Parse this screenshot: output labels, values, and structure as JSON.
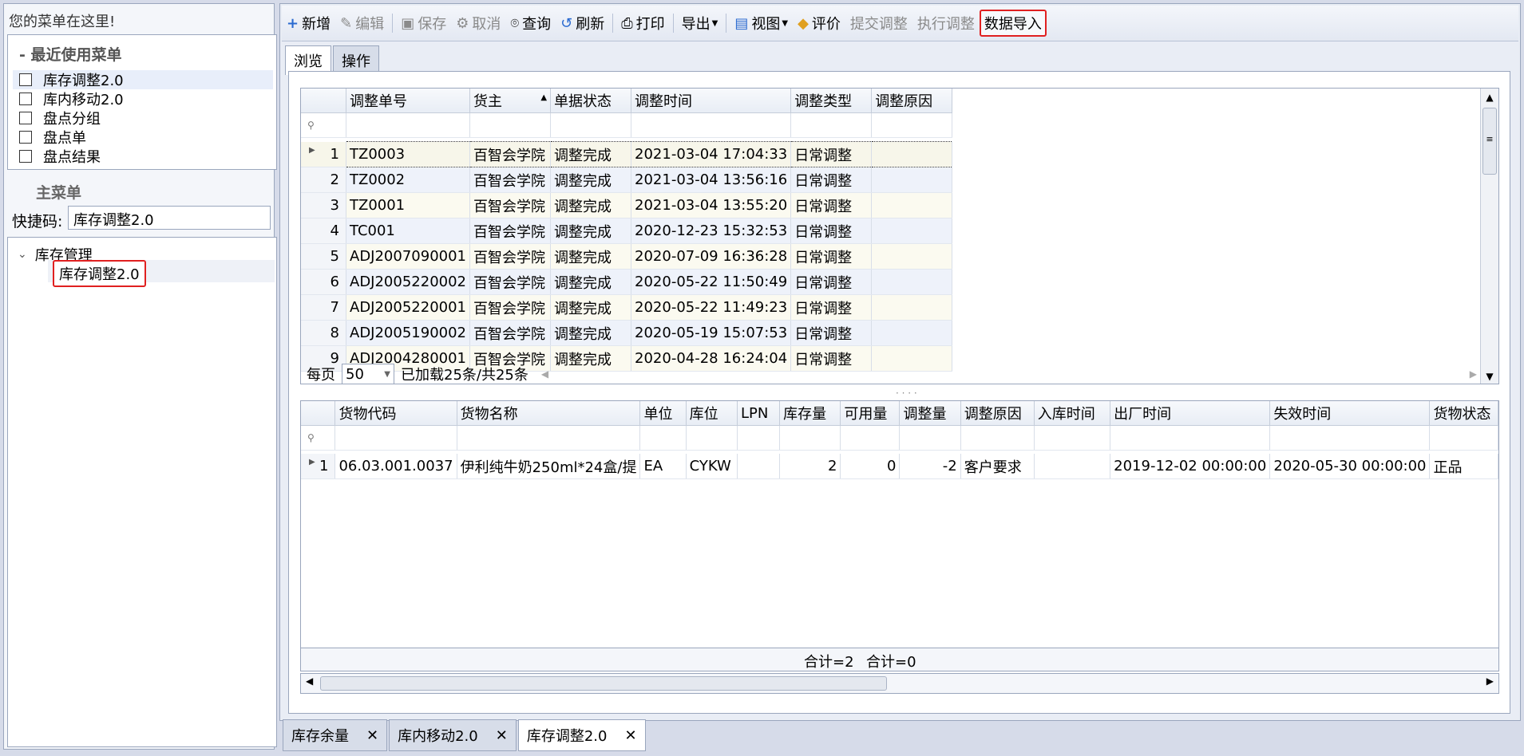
{
  "left_panel": {
    "title": "您的菜单在这里!",
    "recent": {
      "header": "- 最近使用菜单",
      "items": [
        "库存调整2.0",
        "库内移动2.0",
        "盘点分组",
        "盘点单",
        "盘点结果"
      ]
    },
    "main_menu": {
      "header": "主菜单",
      "shortcut_label": "快捷码:",
      "shortcut_value": "库存调整2.0"
    },
    "tree": {
      "root_label": "库存管理",
      "child_label": "库存调整2.0"
    }
  },
  "toolbar": {
    "new": "新增",
    "edit": "编辑",
    "save": "保存",
    "cancel": "取消",
    "query": "查询",
    "refresh": "刷新",
    "print": "打印",
    "export": "导出",
    "view": "视图",
    "rate": "评价",
    "submit_adjust": "提交调整",
    "execute_adjust": "执行调整",
    "data_import": "数据导入"
  },
  "tabs": [
    "浏览",
    "操作"
  ],
  "grid1": {
    "columns": [
      "调整单号",
      "货主",
      "单据状态",
      "调整时间",
      "调整类型",
      "调整原因"
    ],
    "rows": [
      [
        "1",
        "TZ0003",
        "百智会学院",
        "调整完成",
        "2021-03-04 17:04:33",
        "日常调整",
        ""
      ],
      [
        "2",
        "TZ0002",
        "百智会学院",
        "调整完成",
        "2021-03-04 13:56:16",
        "日常调整",
        ""
      ],
      [
        "3",
        "TZ0001",
        "百智会学院",
        "调整完成",
        "2021-03-04 13:55:20",
        "日常调整",
        ""
      ],
      [
        "4",
        "TC001",
        "百智会学院",
        "调整完成",
        "2020-12-23 15:32:53",
        "日常调整",
        ""
      ],
      [
        "5",
        "ADJ2007090001",
        "百智会学院",
        "调整完成",
        "2020-07-09 16:36:28",
        "日常调整",
        ""
      ],
      [
        "6",
        "ADJ2005220002",
        "百智会学院",
        "调整完成",
        "2020-05-22 11:50:49",
        "日常调整",
        ""
      ],
      [
        "7",
        "ADJ2005220001",
        "百智会学院",
        "调整完成",
        "2020-05-22 11:49:23",
        "日常调整",
        ""
      ],
      [
        "8",
        "ADJ2005190002",
        "百智会学院",
        "调整完成",
        "2020-05-19 15:07:53",
        "日常调整",
        ""
      ],
      [
        "9",
        "ADJ2004280001",
        "百智会学院",
        "调整完成",
        "2020-04-28 16:24:04",
        "日常调整",
        ""
      ]
    ]
  },
  "pager": {
    "per_page_label": "每页",
    "per_page_value": "50",
    "loaded_text": "已加载25条/共25条"
  },
  "grid2": {
    "columns": [
      "货物代码",
      "货物名称",
      "单位",
      "库位",
      "LPN",
      "库存量",
      "可用量",
      "调整量",
      "调整原因",
      "入库时间",
      "出厂时间",
      "失效时间",
      "货物状态"
    ],
    "rows": [
      [
        "1",
        "06.03.001.0037",
        "伊利纯牛奶250ml*24盒/提",
        "EA",
        "CYKW",
        "",
        "2",
        "0",
        "-2",
        "客户要求",
        "",
        "2019-12-02 00:00:00",
        "2020-05-30 00:00:00",
        "正品"
      ]
    ],
    "sum1": "合计=2",
    "sum2": "合计=0"
  },
  "bottom_tabs": [
    "库存余量",
    "库内移动2.0",
    "库存调整2.0"
  ]
}
